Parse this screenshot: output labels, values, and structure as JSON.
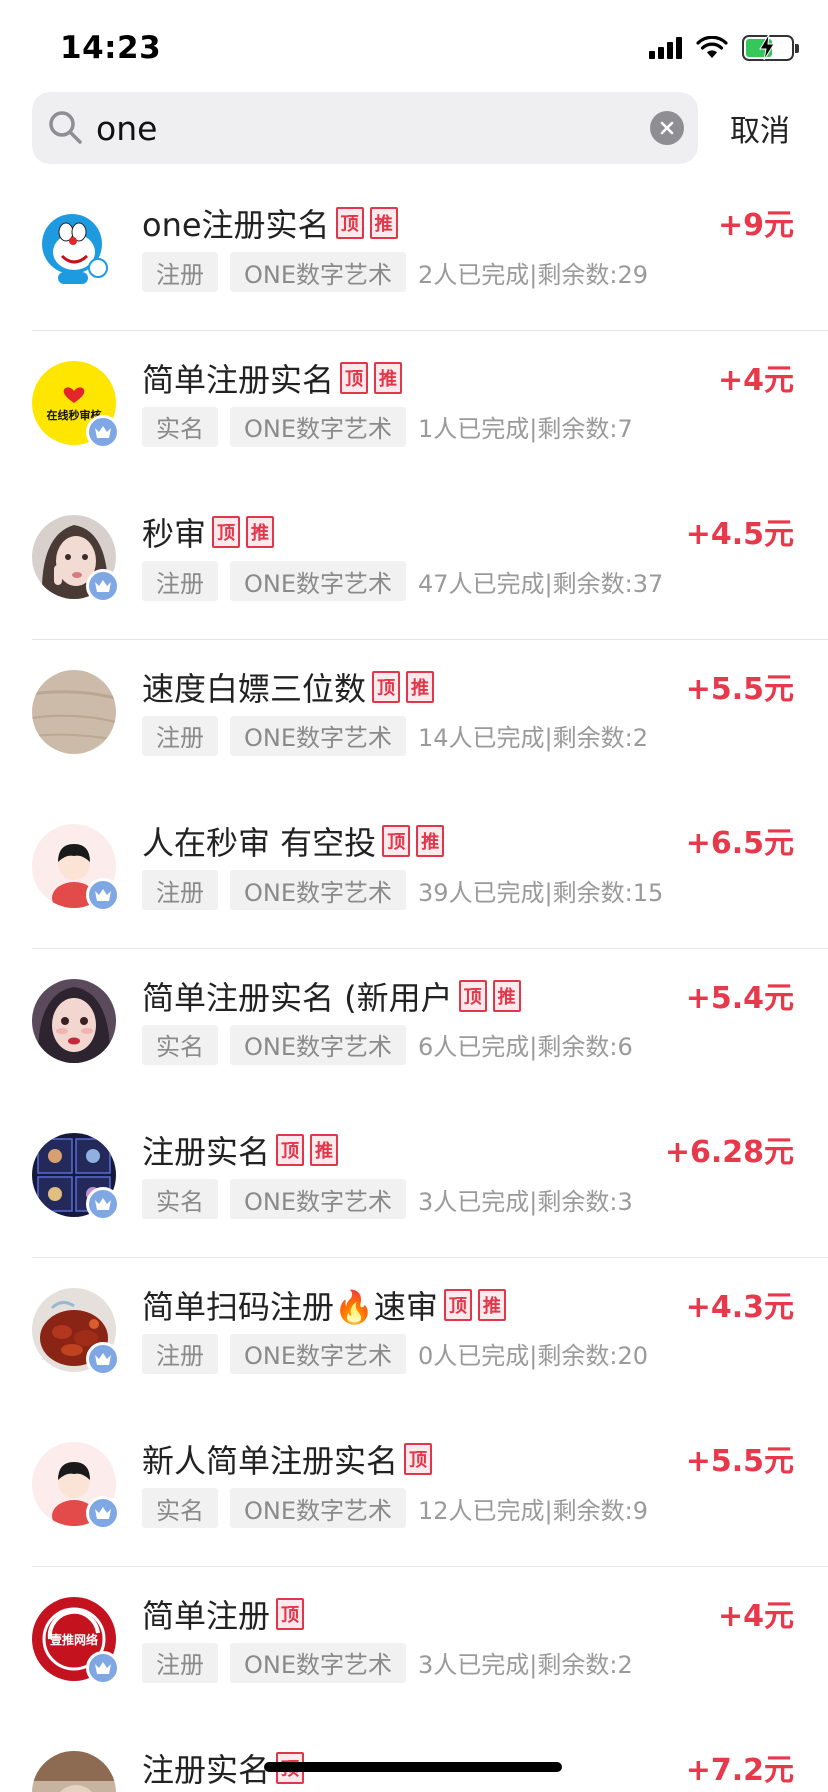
{
  "status_bar": {
    "time": "14:23"
  },
  "search": {
    "query": "one",
    "cancel_label": "取消"
  },
  "tag_labels": {
    "top": "顶",
    "recommend": "推"
  },
  "tasks": [
    {
      "title": "one注册实名",
      "tags": [
        "顶",
        "推"
      ],
      "reward": "+9元",
      "category": "注册",
      "project": "ONE数字艺术",
      "stats": "2人已完成|剩余数:29",
      "verified": false,
      "avatar": "doraemon-avatar"
    },
    {
      "title": "简单注册实名",
      "tags": [
        "顶",
        "推"
      ],
      "reward": "+4元",
      "category": "实名",
      "project": "ONE数字艺术",
      "stats": "1人已完成|剩余数:7",
      "verified": true,
      "avatar": "yellow-logo-avatar",
      "avatar_text": "在线秒审核"
    },
    {
      "title": "秒审",
      "tags": [
        "顶",
        "推"
      ],
      "reward": "+4.5元",
      "category": "注册",
      "project": "ONE数字艺术",
      "stats": "47人已完成|剩余数:37",
      "verified": true,
      "avatar": "girl-photo-avatar"
    },
    {
      "title": "速度白嫖三位数",
      "tags": [
        "顶",
        "推"
      ],
      "reward": "+5.5元",
      "category": "注册",
      "project": "ONE数字艺术",
      "stats": "14人已完成|剩余数:2",
      "verified": false,
      "avatar": "wood-texture-avatar"
    },
    {
      "title": "人在秒审 有空投",
      "tags": [
        "顶",
        "推"
      ],
      "reward": "+6.5元",
      "category": "注册",
      "project": "ONE数字艺术",
      "stats": "39人已完成|剩余数:15",
      "verified": true,
      "avatar": "default-user-avatar"
    },
    {
      "title": "简单注册实名 (新用户",
      "tags": [
        "顶",
        "推"
      ],
      "reward": "+5.4元",
      "category": "实名",
      "project": "ONE数字艺术",
      "stats": "6人已完成|剩余数:6",
      "verified": false,
      "avatar": "girl-makeup-avatar"
    },
    {
      "title": "注册实名",
      "tags": [
        "顶",
        "推"
      ],
      "reward": "+6.28元",
      "category": "实名",
      "project": "ONE数字艺术",
      "stats": "3人已完成|剩余数:3",
      "verified": true,
      "avatar": "game-grid-avatar"
    },
    {
      "title": "简单扫码注册🔥速审",
      "tags": [
        "顶",
        "推"
      ],
      "reward": "+4.3元",
      "category": "注册",
      "project": "ONE数字艺术",
      "stats": "0人已完成|剩余数:20",
      "verified": true,
      "avatar": "crayfish-avatar"
    },
    {
      "title": "新人简单注册实名",
      "tags": [
        "顶"
      ],
      "reward": "+5.5元",
      "category": "实名",
      "project": "ONE数字艺术",
      "stats": "12人已完成|剩余数:9",
      "verified": true,
      "avatar": "default-user-avatar"
    },
    {
      "title": "简单注册",
      "tags": [
        "顶"
      ],
      "reward": "+4元",
      "category": "注册",
      "project": "ONE数字艺术",
      "stats": "3人已完成|剩余数:2",
      "verified": true,
      "avatar": "red-logo-avatar",
      "avatar_text": "壹推网络"
    },
    {
      "title": "注册实名",
      "tags": [
        "顶"
      ],
      "reward": "+7.2元",
      "category": "",
      "project": "",
      "stats": "",
      "verified": false,
      "avatar": "photo-avatar"
    }
  ],
  "colors": {
    "reward": "#e8384b",
    "tag_border": "#e2364a",
    "verified_badge": "#7ea7e4",
    "search_bg": "#efeff1"
  }
}
